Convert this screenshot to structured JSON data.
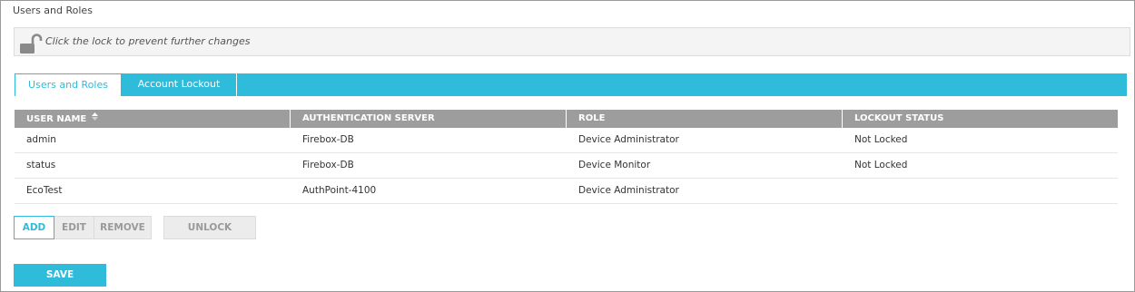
{
  "page": {
    "title": "Users and Roles"
  },
  "lock_bar": {
    "icon": "unlocked-padlock-icon",
    "text": "Click the lock to prevent further changes"
  },
  "tabs": [
    {
      "label": "Users and Roles",
      "active": true
    },
    {
      "label": "Account Lockout",
      "active": false
    }
  ],
  "table": {
    "columns": [
      "USER NAME",
      "AUTHENTICATION SERVER",
      "ROLE",
      "LOCKOUT STATUS"
    ],
    "sort_icon": "sort-icon",
    "rows": [
      [
        "admin",
        "Firebox-DB",
        "Device Administrator",
        "Not Locked"
      ],
      [
        "status",
        "Firebox-DB",
        "Device Monitor",
        "Not Locked"
      ],
      [
        "EcoTest",
        "AuthPoint-4100",
        "Device Administrator",
        ""
      ]
    ]
  },
  "buttons": {
    "add": "ADD",
    "edit": "EDIT",
    "remove": "REMOVE",
    "unlock": "UNLOCK",
    "save": "SAVE"
  },
  "colors": {
    "accent": "#2ebcda",
    "header_bg": "#9d9d9d",
    "disabled_bg": "#ececec",
    "disabled_text": "#9a9a9a"
  }
}
